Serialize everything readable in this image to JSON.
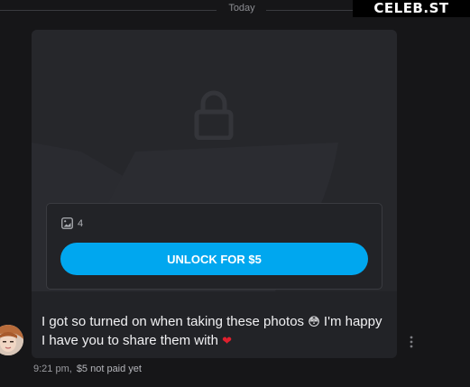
{
  "timeline": {
    "date_label": "Today"
  },
  "watermark": {
    "text": "CELEB.ST"
  },
  "message": {
    "media_count": "4",
    "unlock_label": "UNLOCK FOR $5",
    "text_before_emoji": "I got so turned on when taking these photos ",
    "flushed_emoji": "😳",
    "text_after_emoji": " I'm happy I have you to share them with ",
    "heart_emoji": "❤",
    "time": "9:21 pm,",
    "price_status": "$5 not paid yet"
  },
  "colors": {
    "background": "#161618",
    "card": "#222327",
    "accent_button": "#00a7ef",
    "muted_text": "#8b8c91"
  },
  "icons": [
    "lock-icon",
    "image-icon",
    "more-vertical-icon",
    "avatar"
  ]
}
